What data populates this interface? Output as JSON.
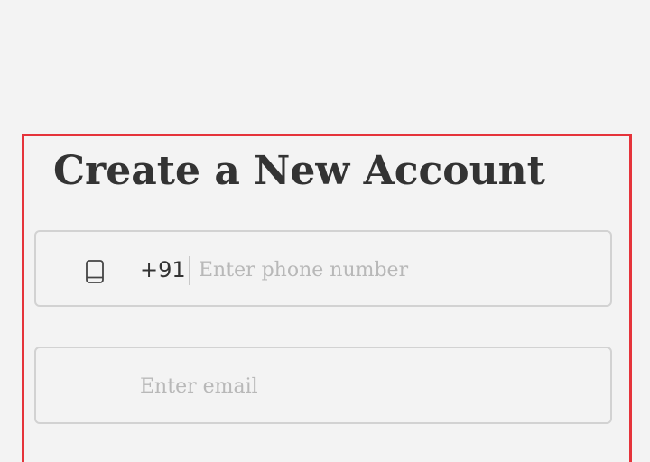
{
  "signup": {
    "title": "Create a New Account",
    "phone": {
      "country_code": "+91",
      "placeholder": "Enter phone number",
      "icon": "mobile-phone-icon"
    },
    "email": {
      "placeholder": "Enter email"
    }
  },
  "colors": {
    "background": "#f3f3f3",
    "highlight_border": "#e5333a",
    "title_text": "#333333",
    "field_border": "#d2d2d2",
    "placeholder": "#b8b8b8"
  }
}
